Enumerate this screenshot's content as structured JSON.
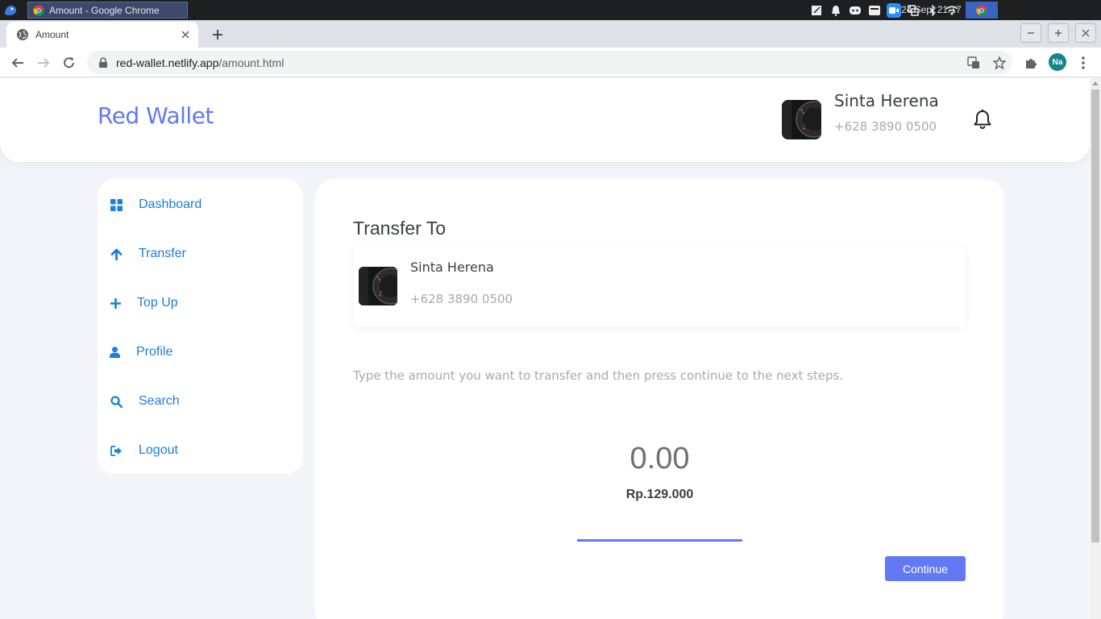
{
  "os": {
    "window_title": "Amount - Google Chrome",
    "clock": "24 Sep, 21:17"
  },
  "browser": {
    "tab_title": "Amount",
    "url_host": "red-wallet.netlify.app",
    "url_path": "/amount.html",
    "profile_initials": "Na"
  },
  "header": {
    "brand": "Red Wallet",
    "user_name": "Sinta Herena",
    "user_phone": "+628 3890 0500"
  },
  "sidebar": {
    "items": [
      {
        "label": "Dashboard",
        "icon": "grid-icon"
      },
      {
        "label": "Transfer",
        "icon": "arrow-up-icon"
      },
      {
        "label": "Top Up",
        "icon": "plus-icon"
      },
      {
        "label": "Profile",
        "icon": "user-icon"
      },
      {
        "label": "Search",
        "icon": "search-icon"
      },
      {
        "label": "Logout",
        "icon": "logout-icon"
      }
    ]
  },
  "transfer": {
    "title": "Transfer To",
    "recipient_name": "Sinta Herena",
    "recipient_phone": "+628 3890 0500",
    "instruction": "Type the amount you want to transfer and then press continue to the next steps.",
    "amount": "0.00",
    "balance": "Rp.129.000",
    "continue_label": "Continue"
  },
  "colors": {
    "accent": "#6379f4",
    "nav_link": "#1a7fe0",
    "page_bg": "#f3f5fb"
  }
}
